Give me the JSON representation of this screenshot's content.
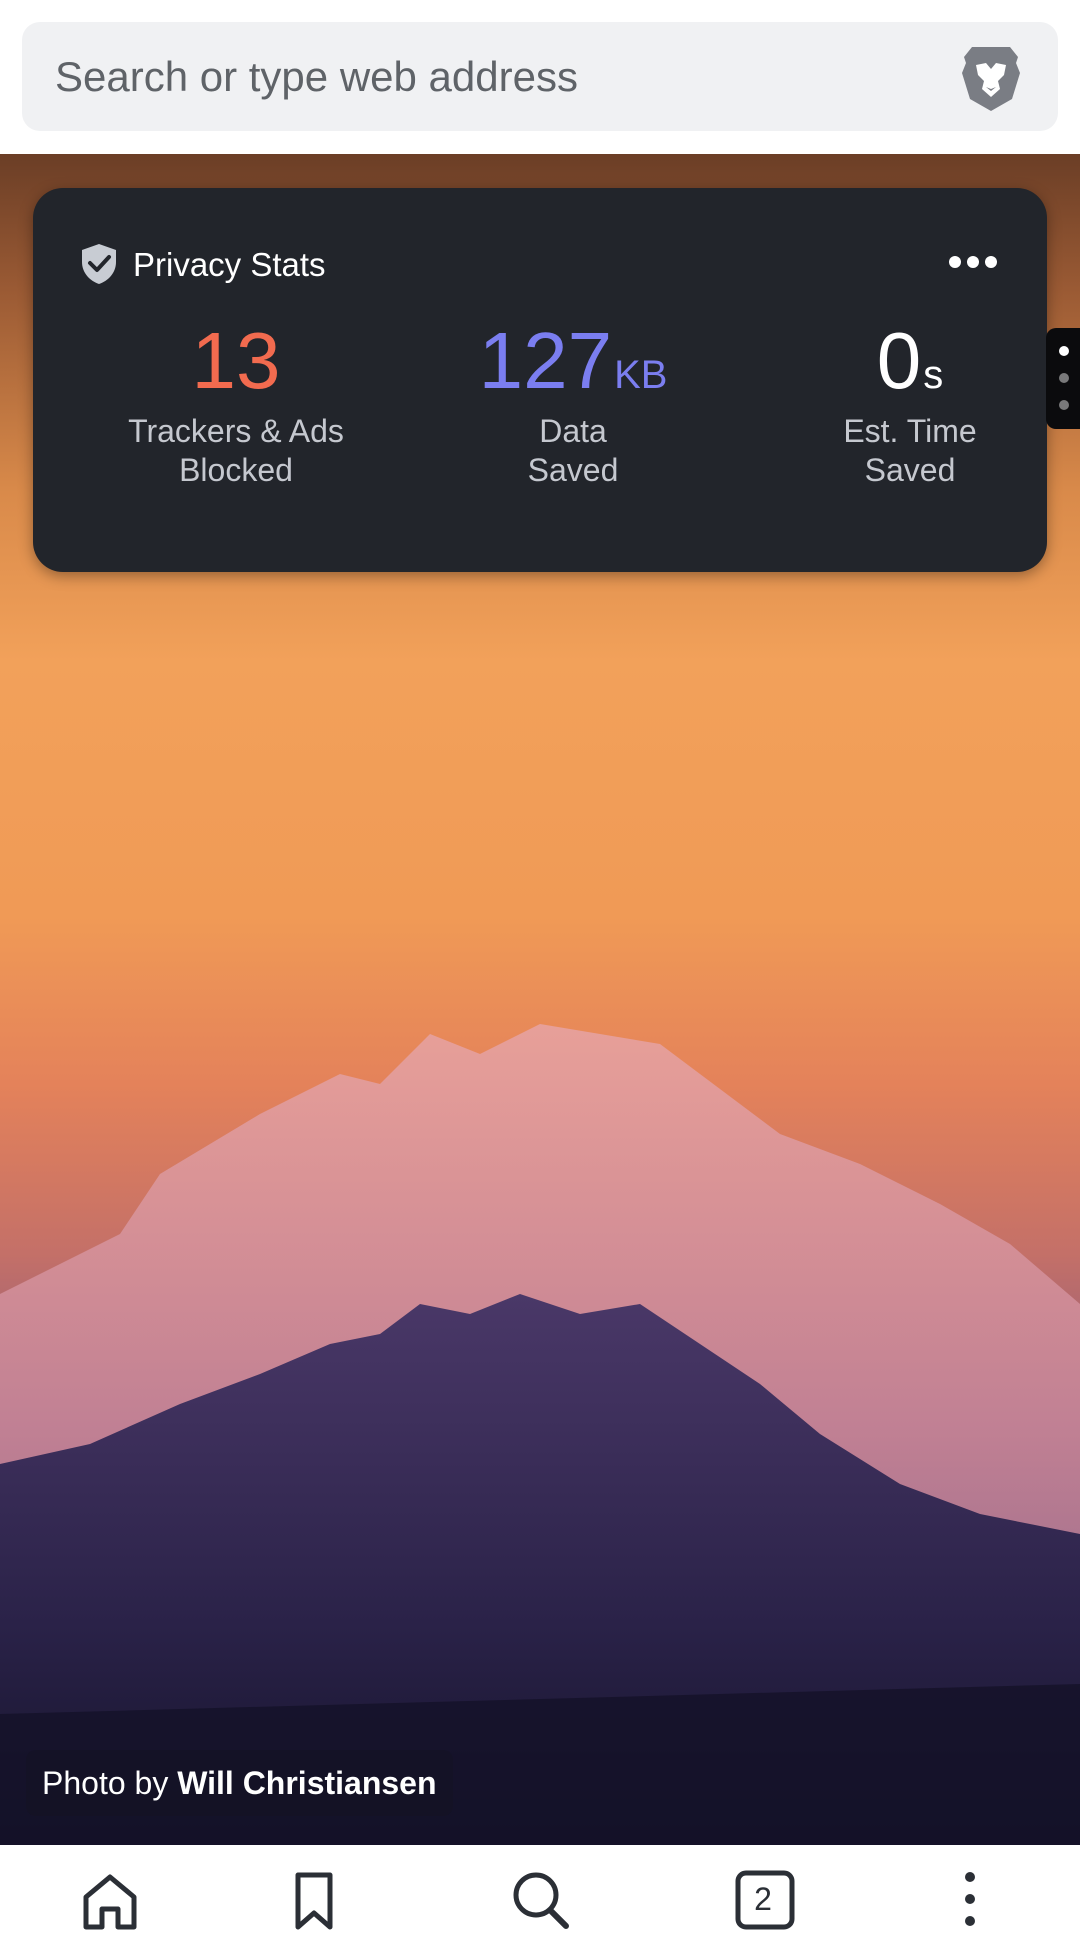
{
  "url_bar": {
    "placeholder": "Search or type web address",
    "brand_icon": "brave-lion-icon"
  },
  "privacy_stats": {
    "title": "Privacy Stats",
    "more_icon": "more-horizontal-icon",
    "stats": [
      {
        "value": "13",
        "unit": "",
        "label_line1": "Trackers & Ads",
        "label_line2": "Blocked",
        "color": "#f26b4f"
      },
      {
        "value": "127",
        "unit": "KB",
        "label_line1": "Data",
        "label_line2": "Saved",
        "color": "#7b7ef0"
      },
      {
        "value": "0",
        "unit": "s",
        "label_line1": "Est. Time",
        "label_line2": "Saved",
        "color": "#ffffff"
      }
    ]
  },
  "photo_credit": {
    "prefix": "Photo by",
    "author": "Will Christiansen"
  },
  "bottom_nav": {
    "items": [
      {
        "icon": "home-icon"
      },
      {
        "icon": "bookmark-icon"
      },
      {
        "icon": "search-icon"
      },
      {
        "icon": "tabs-icon",
        "count": "2"
      },
      {
        "icon": "more-vertical-icon"
      }
    ]
  },
  "colors": {
    "card_bg": "#22252b",
    "trackers": "#f26b4f",
    "data_saved": "#7b7ef0"
  }
}
